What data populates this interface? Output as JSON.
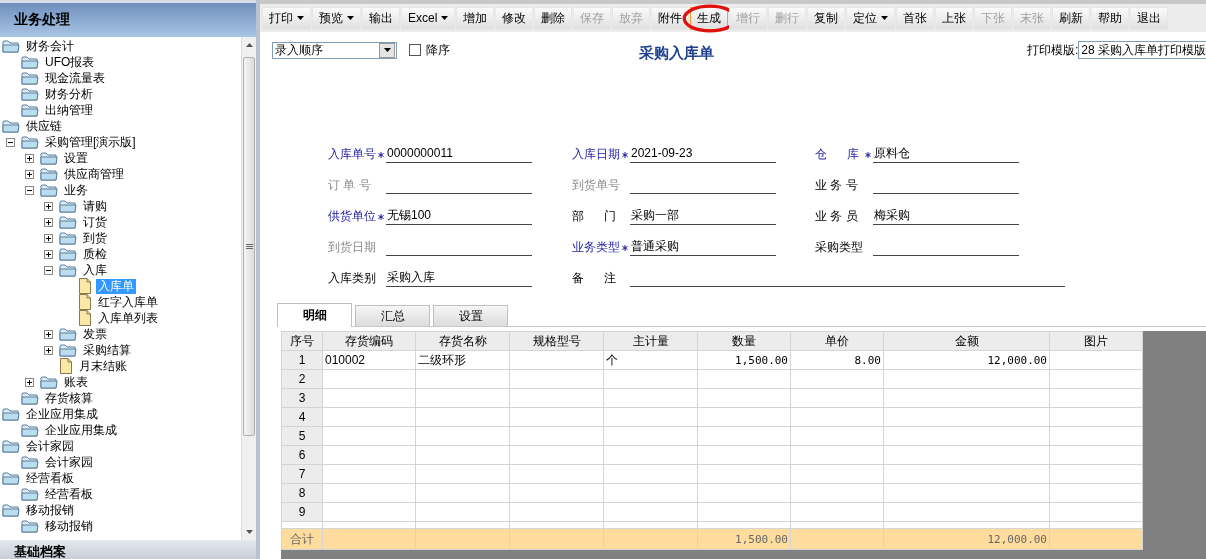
{
  "sidebar": {
    "title": "业务处理",
    "tree": [
      {
        "label": "财务会计",
        "kind": "folder",
        "selected": false,
        "children": [
          {
            "label": "UFO报表",
            "kind": "folder",
            "selected": false
          },
          {
            "label": "现金流量表",
            "kind": "folder",
            "selected": false
          },
          {
            "label": "财务分析",
            "kind": "folder",
            "selected": false
          },
          {
            "label": "出纳管理",
            "kind": "folder",
            "selected": false
          }
        ]
      },
      {
        "label": "供应链",
        "kind": "folder",
        "selected": false,
        "children": [
          {
            "label": "采购管理[演示版]",
            "kind": "folder",
            "selected": false,
            "expanded": true,
            "children": [
              {
                "label": "设置",
                "kind": "folder",
                "selected": false,
                "expanded": false
              },
              {
                "label": "供应商管理",
                "kind": "folder",
                "selected": false,
                "expanded": false
              },
              {
                "label": "业务",
                "kind": "folder",
                "selected": false,
                "expanded": true,
                "children": [
                  {
                    "label": "请购",
                    "kind": "folder",
                    "selected": false,
                    "expanded": false
                  },
                  {
                    "label": "订货",
                    "kind": "folder",
                    "selected": false,
                    "expanded": false
                  },
                  {
                    "label": "到货",
                    "kind": "folder",
                    "selected": false,
                    "expanded": false
                  },
                  {
                    "label": "质检",
                    "kind": "folder",
                    "selected": false,
                    "expanded": false
                  },
                  {
                    "label": "入库",
                    "kind": "folder",
                    "selected": false,
                    "expanded": true,
                    "children": [
                      {
                        "label": "入库单",
                        "kind": "doc",
                        "selected": true
                      },
                      {
                        "label": "红字入库单",
                        "kind": "doc",
                        "selected": false
                      },
                      {
                        "label": "入库单列表",
                        "kind": "doc",
                        "selected": false
                      }
                    ]
                  },
                  {
                    "label": "发票",
                    "kind": "folder",
                    "selected": false,
                    "expanded": false
                  },
                  {
                    "label": "采购结算",
                    "kind": "folder",
                    "selected": false,
                    "expanded": false
                  },
                  {
                    "label": "月末结账",
                    "kind": "doc",
                    "selected": false
                  }
                ]
              },
              {
                "label": "账表",
                "kind": "folder",
                "selected": false,
                "expanded": false
              }
            ]
          },
          {
            "label": "存货核算",
            "kind": "folder",
            "selected": false
          }
        ]
      },
      {
        "label": "企业应用集成",
        "kind": "folder",
        "selected": false,
        "children": [
          {
            "label": "企业应用集成",
            "kind": "folder",
            "selected": false
          }
        ]
      },
      {
        "label": "会计家园",
        "kind": "folder",
        "selected": false,
        "children": [
          {
            "label": "会计家园",
            "kind": "folder",
            "selected": false
          }
        ]
      },
      {
        "label": "经营看板",
        "kind": "folder",
        "selected": false,
        "children": [
          {
            "label": "经营看板",
            "kind": "folder",
            "selected": false
          }
        ]
      },
      {
        "label": "移动报销",
        "kind": "folder",
        "selected": false,
        "children": [
          {
            "label": "移动报销",
            "kind": "folder",
            "selected": false
          }
        ]
      }
    ],
    "footer": "基础档案"
  },
  "toolbar": [
    {
      "label": "打印",
      "dropdown": true,
      "disabled": false,
      "highlighted": false
    },
    {
      "label": "预览",
      "dropdown": true,
      "disabled": false,
      "highlighted": false
    },
    {
      "label": "输出",
      "dropdown": false,
      "disabled": false,
      "highlighted": false
    },
    {
      "label": "Excel",
      "dropdown": true,
      "disabled": false,
      "highlighted": false
    },
    {
      "label": "增加",
      "dropdown": false,
      "disabled": false,
      "highlighted": false
    },
    {
      "label": "修改",
      "dropdown": false,
      "disabled": false,
      "highlighted": false
    },
    {
      "label": "删除",
      "dropdown": false,
      "disabled": false,
      "highlighted": false
    },
    {
      "label": "保存",
      "dropdown": false,
      "disabled": true,
      "highlighted": false
    },
    {
      "label": "放弃",
      "dropdown": false,
      "disabled": true,
      "highlighted": false
    },
    {
      "label": "附件",
      "dropdown": false,
      "disabled": false,
      "highlighted": false
    },
    {
      "label": "生成",
      "dropdown": false,
      "disabled": false,
      "highlighted": true
    },
    {
      "label": "增行",
      "dropdown": false,
      "disabled": true,
      "highlighted": false
    },
    {
      "label": "删行",
      "dropdown": false,
      "disabled": true,
      "highlighted": false
    },
    {
      "label": "复制",
      "dropdown": false,
      "disabled": false,
      "highlighted": false
    },
    {
      "label": "定位",
      "dropdown": true,
      "disabled": false,
      "highlighted": false
    },
    {
      "label": "首张",
      "dropdown": false,
      "disabled": false,
      "highlighted": false
    },
    {
      "label": "上张",
      "dropdown": false,
      "disabled": false,
      "highlighted": false
    },
    {
      "label": "下张",
      "dropdown": false,
      "disabled": true,
      "highlighted": false
    },
    {
      "label": "末张",
      "dropdown": false,
      "disabled": true,
      "highlighted": false
    },
    {
      "label": "刷新",
      "dropdown": false,
      "disabled": false,
      "highlighted": false
    },
    {
      "label": "帮助",
      "dropdown": false,
      "disabled": false,
      "highlighted": false
    },
    {
      "label": "退出",
      "dropdown": false,
      "disabled": false,
      "highlighted": false
    }
  ],
  "form": {
    "sort_select": {
      "value": "录入顺序"
    },
    "descending": {
      "label": "降序",
      "checked": false
    },
    "title": "采购入库单",
    "print_template": {
      "label": "打印模版:",
      "value": "28 采购入库单打印模版"
    },
    "fields": [
      {
        "label": "入库单号",
        "value": "0000000011",
        "required": true,
        "disabled": false
      },
      {
        "label": "入库日期",
        "value": "2021-09-23",
        "required": true,
        "disabled": false
      },
      {
        "label": "仓      库",
        "value": "原料仓",
        "required": true,
        "disabled": false
      },
      {
        "label": "订 单 号",
        "required": false,
        "disabled": true
      },
      {
        "label": "到货单号",
        "required": false,
        "disabled": true
      },
      {
        "label": "业 务 号",
        "required": false,
        "disabled": false
      },
      {
        "label": "供货单位",
        "value": "无锡100",
        "required": true,
        "disabled": false
      },
      {
        "label": "部      门",
        "value": "采购一部",
        "required": false,
        "disabled": false
      },
      {
        "label": "业 务 员",
        "value": "梅采购",
        "required": false,
        "disabled": false
      },
      {
        "label": "到货日期",
        "required": false,
        "disabled": true
      },
      {
        "label": "业务类型",
        "value": "普通采购",
        "required": true,
        "disabled": false
      },
      {
        "label": "采购类型",
        "required": false,
        "disabled": false
      },
      {
        "label": "入库类别",
        "value": "采购入库",
        "required": false,
        "disabled": false
      },
      {
        "label": "备      注",
        "required": false,
        "disabled": false
      }
    ]
  },
  "tabs": [
    {
      "label": "明细",
      "selected": true
    },
    {
      "label": "汇总",
      "selected": false
    },
    {
      "label": "设置",
      "selected": false
    }
  ],
  "grid": {
    "columns": [
      {
        "label": "序号",
        "kind": "text"
      },
      {
        "label": "存货编码",
        "kind": "text"
      },
      {
        "label": "存货名称",
        "kind": "text"
      },
      {
        "label": "规格型号",
        "kind": "text"
      },
      {
        "label": "主计量",
        "kind": "text"
      },
      {
        "label": "数量",
        "kind": "number"
      },
      {
        "label": "单价",
        "kind": "number"
      },
      {
        "label": "金额",
        "kind": "number"
      },
      {
        "label": "图片",
        "kind": "text"
      }
    ],
    "rows": [
      {
        "index": "1",
        "cells": [
          "010002",
          "二级环形",
          null,
          "个",
          "1,500.00",
          "8.00",
          "12,000.00",
          null
        ]
      },
      {
        "index": "2"
      },
      {
        "index": "3"
      },
      {
        "index": "4"
      },
      {
        "index": "5"
      },
      {
        "index": "6"
      },
      {
        "index": "7"
      },
      {
        "index": "8"
      },
      {
        "index": "9"
      }
    ],
    "total": {
      "label": "合计",
      "cells": [
        null,
        null,
        null,
        null,
        "1,500.00",
        null,
        "12,000.00",
        null
      ]
    }
  }
}
